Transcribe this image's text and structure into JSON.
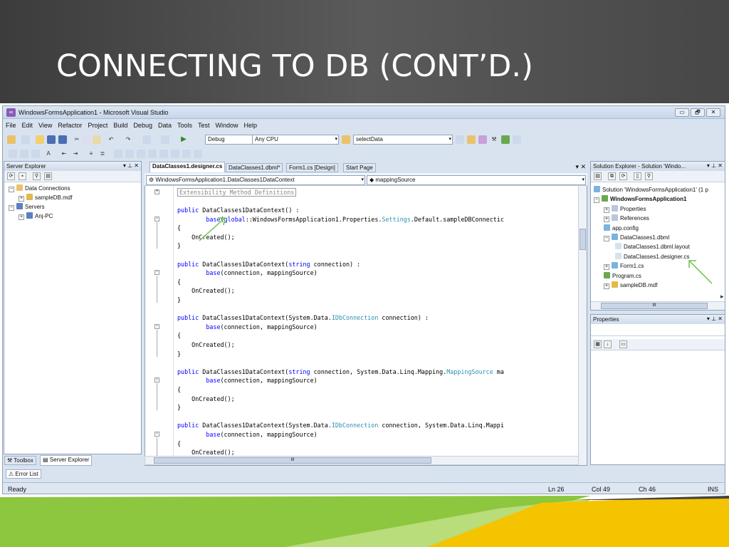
{
  "slide": {
    "title": "CONNECTING TO DB (CONT’D.)",
    "next_icon": "▸"
  },
  "window": {
    "title": "WindowsFormsApplication1 - Microsoft Visual Studio",
    "app_icon": "visual-studio-icon",
    "buttons": {
      "minimize": "▭",
      "restore": "🗗",
      "close": "✕"
    }
  },
  "menu": {
    "items": [
      "File",
      "Edit",
      "View",
      "Refactor",
      "Project",
      "Build",
      "Debug",
      "Data",
      "Tools",
      "Test",
      "Window",
      "Help"
    ]
  },
  "toolbar": {
    "config": "Debug",
    "platform": "Any CPU",
    "find": "selectData"
  },
  "server_explorer": {
    "title": "Server Explorer",
    "pin": "▾ ⊥ ✕",
    "nodes": [
      {
        "exp": "−",
        "label": "Data Connections"
      },
      {
        "exp": "+",
        "label": "sampleDB.mdf"
      },
      {
        "exp": "−",
        "label": "Servers"
      },
      {
        "exp": "+",
        "label": "Anj-PC"
      }
    ],
    "bottom_tabs": {
      "toolbox": "Toolbox",
      "server": "Server Explorer"
    }
  },
  "editor": {
    "tabs": [
      "DataClasses1.designer.cs",
      "DataClasses1.dbml*",
      "Form1.cs [Design]",
      "Start Page"
    ],
    "close": "▾ ✕",
    "nav_left": "WindowsFormsApplication1.DataClasses1DataContext",
    "nav_right": "mappingSource",
    "region": "Extensibility Method Definitions",
    "hscroll_mark": "III",
    "lines": [
      [
        {
          "t": "public",
          "c": "kw"
        },
        {
          "t": " DataClasses1DataContext() :"
        }
      ],
      [
        {
          "t": "        "
        },
        {
          "t": "base",
          "c": "kw"
        },
        {
          "t": "("
        },
        {
          "t": "global",
          "c": "kw"
        },
        {
          "t": "::WindowsFormsApplication1.Properties."
        },
        {
          "t": "Settings",
          "c": "ty"
        },
        {
          "t": ".Default.sampleDBConnectic"
        }
      ],
      [
        {
          "t": "{"
        }
      ],
      [
        {
          "t": "    OnCreated();"
        }
      ],
      [
        {
          "t": "}"
        }
      ],
      [
        {
          "t": ""
        }
      ],
      [
        {
          "t": "public",
          "c": "kw"
        },
        {
          "t": " DataClasses1DataContext("
        },
        {
          "t": "string",
          "c": "kw"
        },
        {
          "t": " connection) :"
        }
      ],
      [
        {
          "t": "        "
        },
        {
          "t": "base",
          "c": "kw"
        },
        {
          "t": "(connection, mappingSource)"
        }
      ],
      [
        {
          "t": "{"
        }
      ],
      [
        {
          "t": "    OnCreated();"
        }
      ],
      [
        {
          "t": "}"
        }
      ],
      [
        {
          "t": ""
        }
      ],
      [
        {
          "t": "public",
          "c": "kw"
        },
        {
          "t": " DataClasses1DataContext(System.Data."
        },
        {
          "t": "IDbConnection",
          "c": "ty"
        },
        {
          "t": " connection) :"
        }
      ],
      [
        {
          "t": "        "
        },
        {
          "t": "base",
          "c": "kw"
        },
        {
          "t": "(connection, mappingSource)"
        }
      ],
      [
        {
          "t": "{"
        }
      ],
      [
        {
          "t": "    OnCreated();"
        }
      ],
      [
        {
          "t": "}"
        }
      ],
      [
        {
          "t": ""
        }
      ],
      [
        {
          "t": "public",
          "c": "kw"
        },
        {
          "t": " DataClasses1DataContext("
        },
        {
          "t": "string",
          "c": "kw"
        },
        {
          "t": " connection, System.Data.Linq.Mapping."
        },
        {
          "t": "MappingSource",
          "c": "ty"
        },
        {
          "t": " ma"
        }
      ],
      [
        {
          "t": "        "
        },
        {
          "t": "base",
          "c": "kw"
        },
        {
          "t": "(connection, mappingSource)"
        }
      ],
      [
        {
          "t": "{"
        }
      ],
      [
        {
          "t": "    OnCreated();"
        }
      ],
      [
        {
          "t": "}"
        }
      ],
      [
        {
          "t": ""
        }
      ],
      [
        {
          "t": "public",
          "c": "kw"
        },
        {
          "t": " DataClasses1DataContext(System.Data."
        },
        {
          "t": "IDbConnection",
          "c": "ty"
        },
        {
          "t": " connection, System.Data.Linq.Mappi"
        }
      ],
      [
        {
          "t": "        "
        },
        {
          "t": "base",
          "c": "kw"
        },
        {
          "t": "(connection, mappingSource)"
        }
      ],
      [
        {
          "t": "{"
        }
      ],
      [
        {
          "t": "    OnCreated();"
        }
      ]
    ]
  },
  "solution_explorer": {
    "title": "Solution Explorer - Solution 'Windo...",
    "pin": "▾ ⊥ ✕",
    "nodes": [
      {
        "exp": "",
        "label": "Solution 'WindowsFormsApplication1' (1 p"
      },
      {
        "exp": "−",
        "label": "WindowsFormsApplication1"
      },
      {
        "exp": "+",
        "label": "Properties"
      },
      {
        "exp": "+",
        "label": "References"
      },
      {
        "exp": "",
        "label": "app.config"
      },
      {
        "exp": "−",
        "label": "DataClasses1.dbml"
      },
      {
        "exp": "",
        "label": "DataClasses1.dbml.layout"
      },
      {
        "exp": "",
        "label": "DataClasses1.designer.cs"
      },
      {
        "exp": "+",
        "label": "Form1.cs"
      },
      {
        "exp": "",
        "label": "Program.cs"
      },
      {
        "exp": "+",
        "label": "sampleDB.mdf"
      }
    ],
    "hscroll_mark": "III"
  },
  "properties": {
    "title": "Properties",
    "pin": "▾ ⊥ ✕"
  },
  "error_list": {
    "label": "Error List"
  },
  "status": {
    "ready": "Ready",
    "ln": "Ln 26",
    "col": "Col 49",
    "ch": "Ch 46",
    "ins": "INS"
  },
  "colors": {
    "accent_green": "#8dc63f",
    "accent_yellow": "#f5c400",
    "arrow": "#6cc24a"
  }
}
